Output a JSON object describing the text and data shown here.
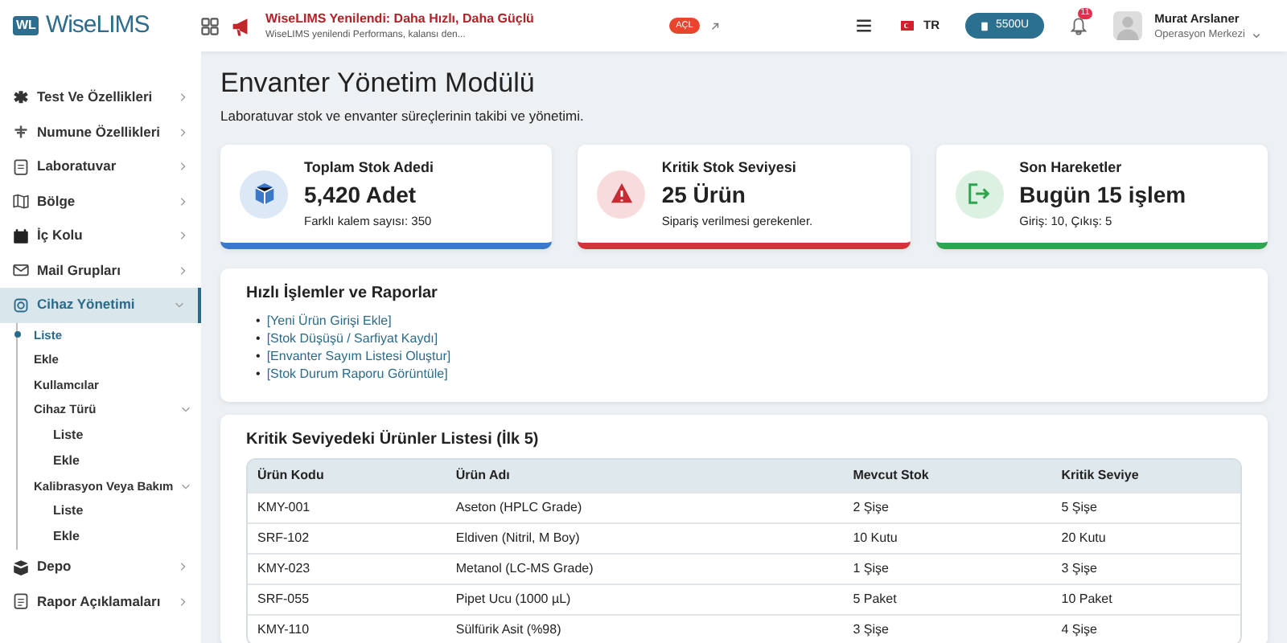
{
  "header": {
    "logo_badge": "WL",
    "logo_text": "WiseLIMS",
    "announcement": {
      "title": "WiseLIMS Yenilendi: Daha Hızlı, Daha Güçlü",
      "text": "WiseLIMS yenilendi Performans, kalansı den...",
      "badge": "AÇL"
    },
    "language": "TR",
    "code_button": "5500U",
    "notifications": "11",
    "user": {
      "name": "Murat Arslaner",
      "role": "Operasyon Merkezi"
    }
  },
  "sidebar": {
    "items": [
      {
        "label": "Test Ve Özellikleri",
        "expanded": false,
        "selected": false
      },
      {
        "label": "Numune Özellikleri",
        "expanded": false,
        "selected": false
      },
      {
        "label": "Laboratuvar",
        "expanded": false,
        "selected": false
      },
      {
        "label": "Bölge",
        "expanded": false,
        "selected": false
      },
      {
        "label": "İç Kolu",
        "expanded": false,
        "selected": false
      },
      {
        "label": "Mail Grupları",
        "expanded": false,
        "selected": false
      },
      {
        "label": "Cihaz Yönetimi",
        "expanded": true,
        "selected": true,
        "children": [
          {
            "label": "Liste",
            "selected": true
          },
          {
            "label": "Ekle",
            "selected": false
          },
          {
            "label": "Kullamcılar",
            "selected": false
          },
          {
            "label": "Cihaz Türü",
            "selected": false,
            "expanded": true,
            "children": [
              {
                "label": "Liste",
                "selected": false
              },
              {
                "label": "Ekle",
                "selected": false
              }
            ]
          },
          {
            "label": "Kalibrasyon Veya Bakım",
            "selected": false,
            "expanded": true,
            "children": [
              {
                "label": "Liste",
                "selected": false
              },
              {
                "label": "Ekle",
                "selected": false
              }
            ]
          }
        ]
      },
      {
        "label": "Depo",
        "expanded": false,
        "selected": false
      },
      {
        "label": "Rapor Açıklamaları",
        "expanded": false,
        "selected": false
      }
    ]
  },
  "page": {
    "title": "Envanter Yönetim Modülü",
    "subtitle": "Laboratuvar stok ve envanter süreçlerinin takibi ve yönetimi."
  },
  "stats": [
    {
      "kind": "box",
      "title": "Toplam Stok Adedi",
      "value": "5,420 Adet",
      "note": "Farklı kalem sayısı: 350",
      "color": "#3a78c9"
    },
    {
      "kind": "warning",
      "title": "Kritik Stok Seviyesi",
      "value": "25 Ürün",
      "note": "Sipariş verilmesi gerekenler.",
      "color": "#d2343a"
    },
    {
      "kind": "exit",
      "title": "Son Hareketler",
      "value": "Bugün 15 işlem",
      "note": "Giriş: 10, Çıkış: 5",
      "color": "#2ea44f"
    }
  ],
  "quick_actions": {
    "title": "Hızlı İşlemler ve Raporlar",
    "items": [
      {
        "bullet": "•",
        "label": "[Yeni Ürün Girişi Ekle]"
      },
      {
        "bullet": "•",
        "label": "[Stok Düşüşü / Sarfiyat Kaydı]"
      },
      {
        "bullet": "•",
        "label": "[Envanter Sayım Listesi Oluştur]"
      },
      {
        "bullet": "•",
        "label": "[Stok Durum Raporu Görüntüle]"
      }
    ]
  },
  "critical_table": {
    "title": "Kritik Seviyedeki Ürünler Listesi (İlk 5)",
    "columns": [
      "Ürün Kodu",
      "Ürün Adı",
      "Mevcut Stok",
      "Kritik Seviye"
    ],
    "rows": [
      [
        "KMY-001",
        "Aseton (HPLC Grade)",
        "2 Şişe",
        "5 Şişe"
      ],
      [
        "SRF-102",
        "Eldiven (Nitril, M Boy)",
        "10 Kutu",
        "20 Kutu"
      ],
      [
        "KMY-023",
        "Metanol (LC-MS Grade)",
        "1 Şişe",
        "3 Şişe"
      ],
      [
        "SRF-055",
        "Pipet Ucu (1000 µL)",
        "5 Paket",
        "10 Paket"
      ],
      [
        "KMY-110",
        "Sülfürik Asit (%98)",
        "3 Şişe",
        "4 Şişe"
      ]
    ]
  }
}
